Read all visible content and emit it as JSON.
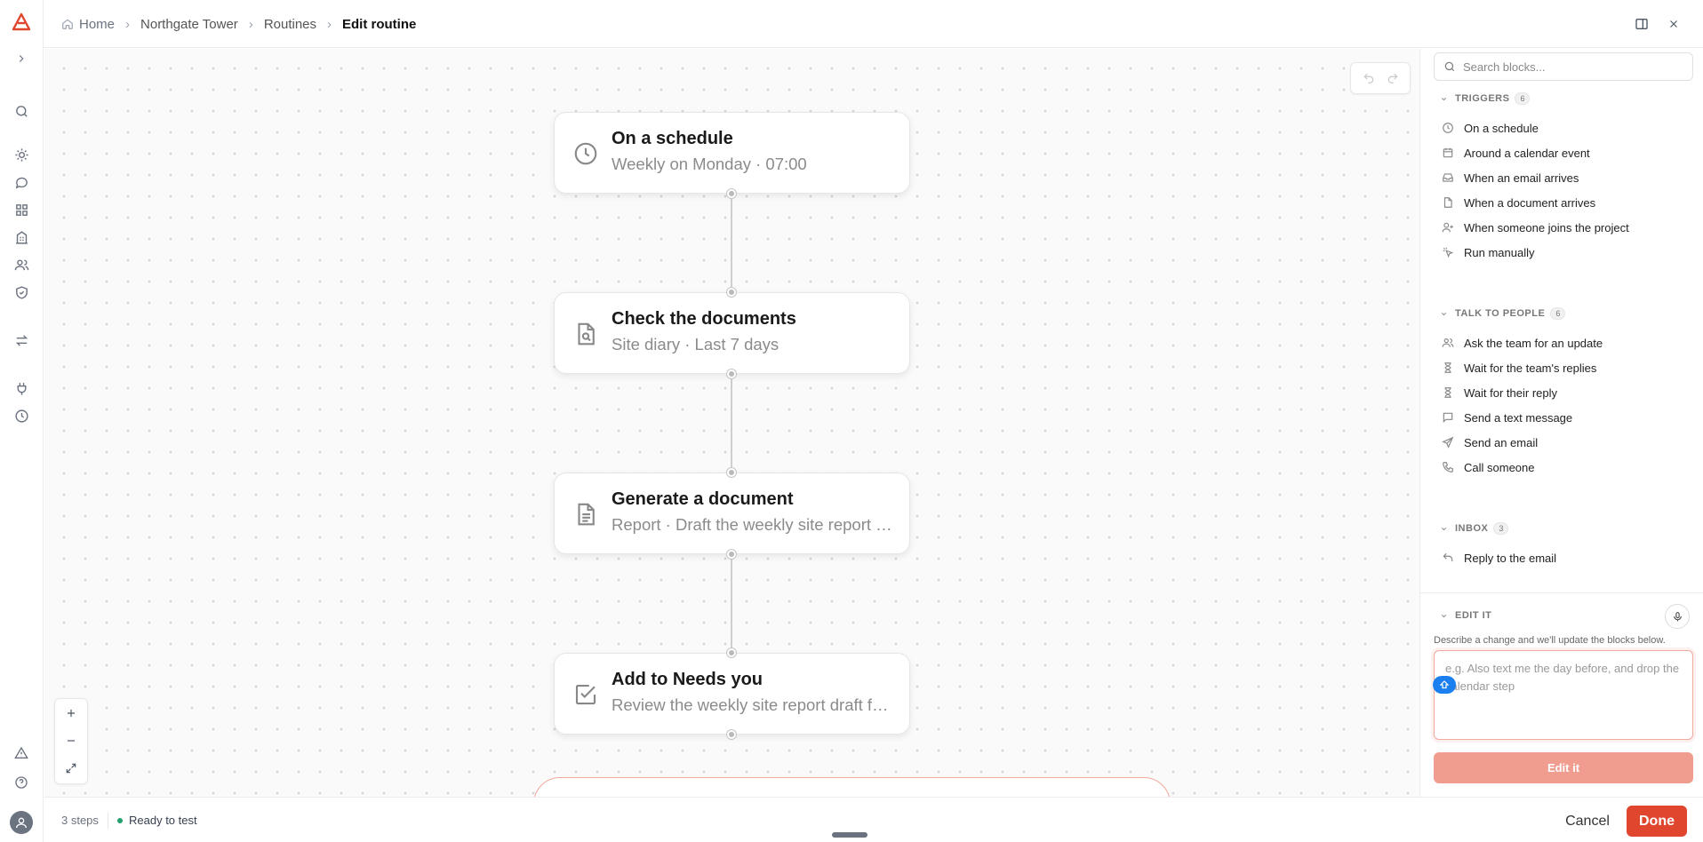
{
  "breadcrumb": {
    "home": "Home",
    "project": "Northgate Tower",
    "section": "Routines",
    "current": "Edit routine"
  },
  "rail": {
    "icons": [
      "logo-icon",
      "expand-icon",
      "search-icon",
      "sun-icon",
      "chat-icon",
      "grid-icon",
      "building-icon",
      "users-icon",
      "shield-icon",
      "swap-icon",
      "plug-icon",
      "clock-icon",
      "alert-icon",
      "help-icon",
      "user-avatar-icon"
    ]
  },
  "canvas": {
    "nodes": [
      {
        "title": "On a schedule",
        "subtitle": "Weekly on Monday · 07:00",
        "icon": "clock-icon"
      },
      {
        "title": "Check the documents",
        "subtitle": "Site diary · Last 7 days",
        "icon": "document-search-icon"
      },
      {
        "title": "Generate a document",
        "subtitle": "Report · Draft the weekly site report for this week",
        "icon": "document-icon"
      },
      {
        "title": "Add to Needs you",
        "subtitle": "Review the weekly site report draft for this week",
        "icon": "checkbox-icon"
      }
    ]
  },
  "footer": {
    "steps": "3 steps",
    "status": "Ready to test",
    "cancel": "Cancel",
    "done": "Done"
  },
  "panel": {
    "search_placeholder": "Search blocks...",
    "triggers": {
      "label": "TRIGGERS",
      "count": "6",
      "items": [
        "On a schedule",
        "Around a calendar event",
        "When an email arrives",
        "When a document arrives",
        "When someone joins the project",
        "Run manually"
      ]
    },
    "talk": {
      "label": "TALK TO PEOPLE",
      "count": "6",
      "items": [
        "Ask the team for an update",
        "Wait for the team's replies",
        "Wait for their reply",
        "Send a text message",
        "Send an email",
        "Call someone"
      ]
    },
    "inbox": {
      "label": "INBOX",
      "count": "3",
      "items": [
        "Reply to the email"
      ]
    },
    "edit": {
      "label": "EDIT IT",
      "description": "Describe a change and we'll update the blocks below.",
      "placeholder": "e.g. Also text me the day before, and drop the calendar step",
      "button": "Edit it"
    }
  },
  "colors": {
    "accent": "#e0452e",
    "accent_light": "#f09d8f",
    "status_green": "#22a06b"
  }
}
